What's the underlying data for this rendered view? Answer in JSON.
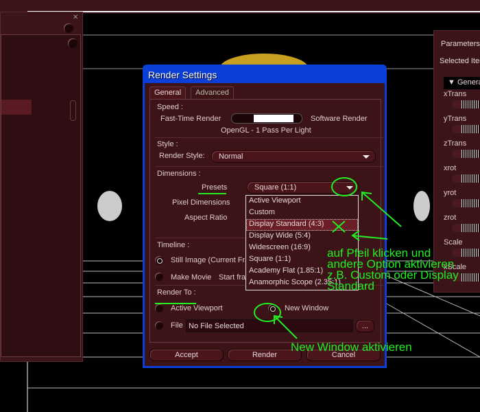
{
  "dialog": {
    "title": "Render Settings",
    "tabs": [
      {
        "label": "General"
      },
      {
        "label": "Advanced"
      }
    ],
    "speed": {
      "heading": "Speed :",
      "left_label": "Fast-Time Render",
      "right_label": "Software Render",
      "mode_text": "OpenGL - 1 Pass Per Light"
    },
    "style": {
      "heading": "Style :",
      "render_style_label": "Render Style:",
      "render_style_value": "Normal"
    },
    "dimensions": {
      "heading": "Dimensions :",
      "presets_label": "Presets",
      "presets_value": "Square (1:1)",
      "pixel_dimensions_label": "Pixel Dimensions",
      "aspect_ratio_label": "Aspect Ratio",
      "options": [
        "Active Viewport",
        "Custom",
        "Display Standard (4:3)",
        "Display Wide (5:4)",
        "Widescreen (16:9)",
        "Square (1:1)",
        "Academy Flat (1.85:1)",
        "Anamorphic Scope (2.35:1)"
      ],
      "highlighted_option": "Display Standard (4:3)"
    },
    "timeline": {
      "heading": "Timeline :",
      "still_image": "Still Image (Current Frame)",
      "make_movie": "Make Movie",
      "start_frame": "Start frame"
    },
    "render_to": {
      "heading": "Render To :",
      "active_viewport": "Active Viewport",
      "new_window": "New Window",
      "file": "File",
      "file_value": "No File Selected",
      "browse": "..."
    },
    "buttons": {
      "accept": "Accept",
      "render": "Render",
      "cancel": "Cancel"
    }
  },
  "parameters_panel": {
    "title": "Parameters",
    "selected_item": "Selected Item",
    "group": "General",
    "params": [
      "xTrans",
      "yTrans",
      "zTrans",
      "xrot",
      "yrot",
      "zrot",
      "Scale",
      "xScale"
    ]
  },
  "annotations": {
    "presets_hint": [
      "auf Pfeil klicken und",
      "andere Option aktivieren",
      "z.B. Custom oder Display",
      "Standard"
    ],
    "render_to_hint": "New Window aktivieren"
  },
  "colors": {
    "annotation": "#22ee22",
    "titlebar": "#0a3fd8",
    "panel": "#3c1418"
  }
}
